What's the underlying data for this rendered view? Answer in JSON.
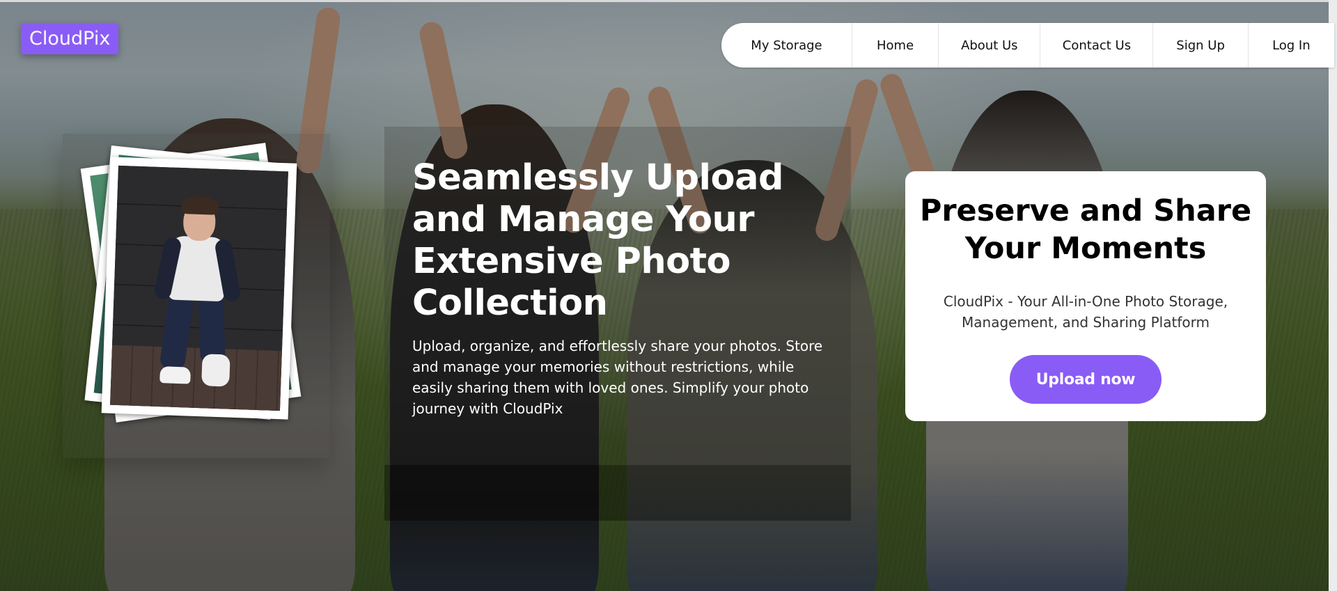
{
  "brand": {
    "logo_text": "CloudPix",
    "accent_color": "#8a5cf6"
  },
  "nav": {
    "items": [
      {
        "label": "My Storage"
      },
      {
        "label": "Home"
      },
      {
        "label": "About Us"
      },
      {
        "label": "Contact Us"
      },
      {
        "label": "Sign Up"
      },
      {
        "label": "Log In"
      }
    ]
  },
  "hero": {
    "title": "Seamlessly Upload and Manage Your Extensive Photo Collection",
    "description": "Upload, organize, and effortlessly share your photos. Store and manage your memories without restrictions, while easily sharing them with loved ones. Simplify your photo journey with CloudPix"
  },
  "cta": {
    "title": "Preserve and Share Your Moments",
    "subtitle": "CloudPix - Your All-in-One Photo Storage, Management, and Sharing Platform",
    "button_label": "Upload now"
  },
  "icons": {
    "photo_stack": "photo-stack-icon"
  }
}
